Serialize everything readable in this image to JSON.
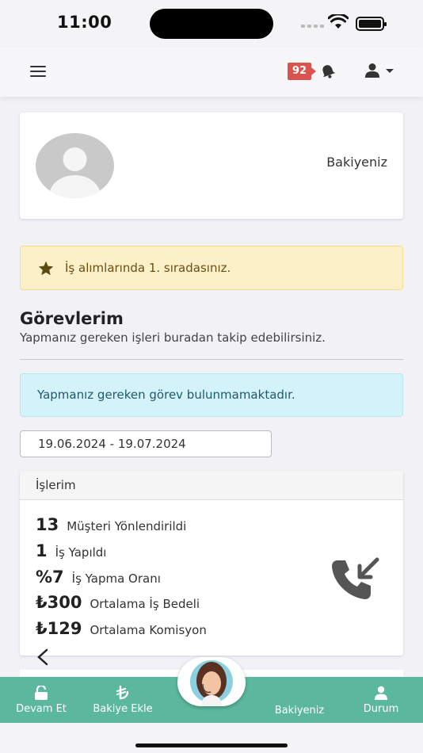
{
  "status_bar": {
    "time": "11:00"
  },
  "topnav": {
    "notification_count": "92"
  },
  "profile": {
    "balance_label": "Bakiyeniz"
  },
  "alerts": {
    "rank": "İş alımlarında 1. sıradasınız.",
    "no_tasks": "Yapmanız gereken görev bulunmamaktadır."
  },
  "tasks": {
    "title": "Görevlerim",
    "subtitle": "Yapmanız gereken işleri buradan takip edebilirsiniz."
  },
  "date_range": {
    "value": "19.06.2024 - 19.07.2024"
  },
  "stats": {
    "header": "İşlerim",
    "rows": [
      {
        "value": "13",
        "label": "Müşteri Yönlendirildi"
      },
      {
        "value": "1",
        "label": "İş Yapıldı"
      },
      {
        "value": "%7",
        "label": "İş Yapma Oranı"
      },
      {
        "value": "₺300",
        "label": "Ortalama İş Bedeli"
      },
      {
        "value": "₺129",
        "label": "Ortalama Komisyon"
      }
    ]
  },
  "bottom_nav": {
    "items": [
      {
        "label": "Devam Et",
        "icon": "lock-open-icon"
      },
      {
        "label": "Bakiye Ekle",
        "icon": "lira-icon"
      },
      {
        "label": "Bakiyeniz",
        "icon": ""
      },
      {
        "label": "Durum",
        "icon": "user-icon"
      }
    ]
  },
  "colors": {
    "nav_green": "#5bb89f",
    "badge_red": "#d9534f",
    "warning_bg": "#fcf0c9",
    "info_bg": "#d4f2fa"
  }
}
